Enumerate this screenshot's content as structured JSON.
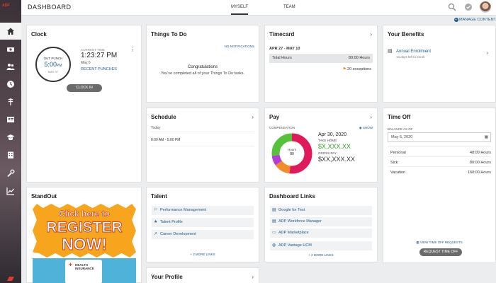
{
  "app": {
    "logo_text": "ADP"
  },
  "header": {
    "title": "DASHBOARD",
    "tabs": [
      "MYSELF",
      "TEAM"
    ],
    "manage": "MANAGE CONTENT"
  },
  "clock": {
    "title": "Clock",
    "out_punch": "OUT PUNCH",
    "out_time": "5:00",
    "out_ampm": "PM",
    "out_date": "MAY 07",
    "current_label": "CURRENT TIME",
    "current_time": "1:23:27 PM",
    "current_date": "May 6",
    "recent": "RECENT PUNCHES",
    "clock_in": "CLOCK IN"
  },
  "todo": {
    "title": "Things To Do",
    "notif": "NO NOTIFICATIONS",
    "congrats": "Congratulations",
    "msg": "You've completed all of your Things To Do tasks."
  },
  "timecard": {
    "title": "Timecard",
    "range": "APR 27 - MAY 10",
    "total_label": "Total Hours",
    "total_value": "80:00 Hours",
    "exceptions": "20 exceptions"
  },
  "benefits": {
    "title": "Your Benefits",
    "item": "Annual Enrollment",
    "sub": "14 days left to enroll"
  },
  "schedule": {
    "title": "Schedule",
    "today": "Today",
    "time": "8:00 AM - 5:00 PM"
  },
  "pay": {
    "title": "Pay",
    "compensation": "COMPENSATION",
    "show": "SHOW",
    "date": "Apr 30, 2020",
    "take_home_label": "TAKE HOME",
    "take_home": "$X,XXX.XX",
    "gross_label": "GROSS PAY",
    "gross": "$XX,XXX.XX",
    "donut_label": "Hours",
    "donut_value": "80",
    "slices": [
      {
        "value": 0.52,
        "color": "#e0195a"
      },
      {
        "value": 0.13,
        "color": "#f28c28"
      },
      {
        "value": 0.08,
        "color": "#b43bd8"
      },
      {
        "value": 0.27,
        "color": "#55c23a"
      }
    ]
  },
  "timeoff": {
    "title": "Time Off",
    "balance_label": "BALANCE AS OF",
    "date": "May 6, 2020",
    "rows": [
      {
        "name": "Personal",
        "value": "48:00 Hours"
      },
      {
        "name": "Sick",
        "value": "80:00 Hours"
      },
      {
        "name": "Vacation",
        "value": "160:00 Hours"
      }
    ],
    "view_requests": "VIEW TIME OFF REQUESTS",
    "request": "REQUEST TIME OFF"
  },
  "standout": {
    "title": "StandOut",
    "banner_line1": "Click here to",
    "banner_line2": "REGISTER",
    "banner_line3": "NOW!",
    "health": "HEALTH INSURANCE"
  },
  "talent": {
    "title": "Talent",
    "links": [
      "Performance Management",
      "Talent Profile",
      "Career Development"
    ],
    "more": "+ 3 MORE LINKS"
  },
  "dlinks": {
    "title": "Dashboard Links",
    "links": [
      "Google for Test",
      "ADP Workforce Manager",
      "ADP Marketplace",
      "ADP Vantage HCM"
    ],
    "more": "+ 2 MORE LINKS"
  },
  "profile": {
    "title": "Your Profile"
  }
}
